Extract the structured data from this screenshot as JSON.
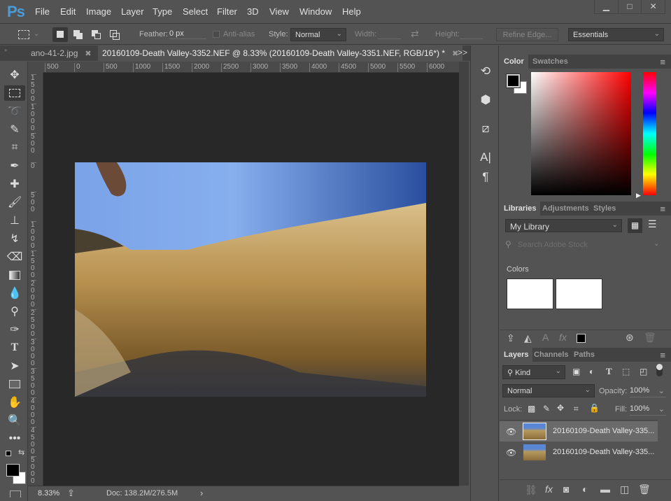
{
  "app": {
    "logo": "Ps"
  },
  "menu": [
    {
      "label": "File",
      "key": "F"
    },
    {
      "label": "Edit",
      "key": "E"
    },
    {
      "label": "Image",
      "key": "I"
    },
    {
      "label": "Layer",
      "key": "L"
    },
    {
      "label": "Type",
      "key": "y"
    },
    {
      "label": "Select",
      "key": "S"
    },
    {
      "label": "Filter",
      "key": "t"
    },
    {
      "label": "3D",
      "key": "D"
    },
    {
      "label": "View",
      "key": "V"
    },
    {
      "label": "Window",
      "key": "W"
    },
    {
      "label": "Help",
      "key": "H"
    }
  ],
  "window_controls": {
    "minimize": "▁",
    "maximize": "□",
    "close": "✕"
  },
  "options": {
    "feather_label": "Feather:",
    "feather_value": "0 px",
    "antialias_label": "Anti-alias",
    "style_label": "Style:",
    "style_value": "Normal",
    "width_label": "Width:",
    "height_label": "Height:",
    "refine_edge": "Refine Edge...",
    "workspace": "Essentials"
  },
  "tabs": [
    {
      "label": "ano-41-2.jpg",
      "active": false
    },
    {
      "label": "20160109-Death Valley-3352.NEF @ 8.33% (20160109-Death Valley-3351.NEF, RGB/16*) *",
      "active": true
    }
  ],
  "tabs_overflow": ">>",
  "hruler": [
    "500",
    "0",
    "500",
    "1000",
    "1500",
    "2000",
    "2500",
    "3000",
    "3500",
    "4000",
    "4500",
    "5000",
    "5500",
    "6000"
  ],
  "vruler": [
    "1500",
    "1000",
    "500",
    "0",
    "500",
    "1000",
    "1500",
    "2000",
    "2500",
    "3000",
    "3500",
    "4000",
    "4500",
    "5000"
  ],
  "status": {
    "zoom": "8.33%",
    "doc": "Doc: 138.2M/276.5M",
    "arrow": "›"
  },
  "color_panel": {
    "tabs": [
      "Color",
      "Swatches"
    ],
    "foreground": "#000000",
    "background": "#ffffff",
    "hue_color": "#ff0000"
  },
  "libraries_panel": {
    "tabs": [
      "Libraries",
      "Adjustments",
      "Styles"
    ],
    "library": "My Library",
    "search_placeholder": "Search Adobe Stock",
    "section_title": "Colors",
    "swatches": [
      "#ffffff",
      "#ffffff"
    ]
  },
  "layers_panel": {
    "tabs": [
      "Layers",
      "Channels",
      "Paths"
    ],
    "filter": "Kind",
    "blend_mode": "Normal",
    "opacity_label": "Opacity:",
    "opacity": "100%",
    "lock_label": "Lock:",
    "fill_label": "Fill:",
    "fill": "100%",
    "layers": [
      {
        "name": "20160109-Death Valley-335...",
        "visible": true,
        "selected": true
      },
      {
        "name": "20160109-Death Valley-335...",
        "visible": true,
        "selected": false
      }
    ]
  }
}
